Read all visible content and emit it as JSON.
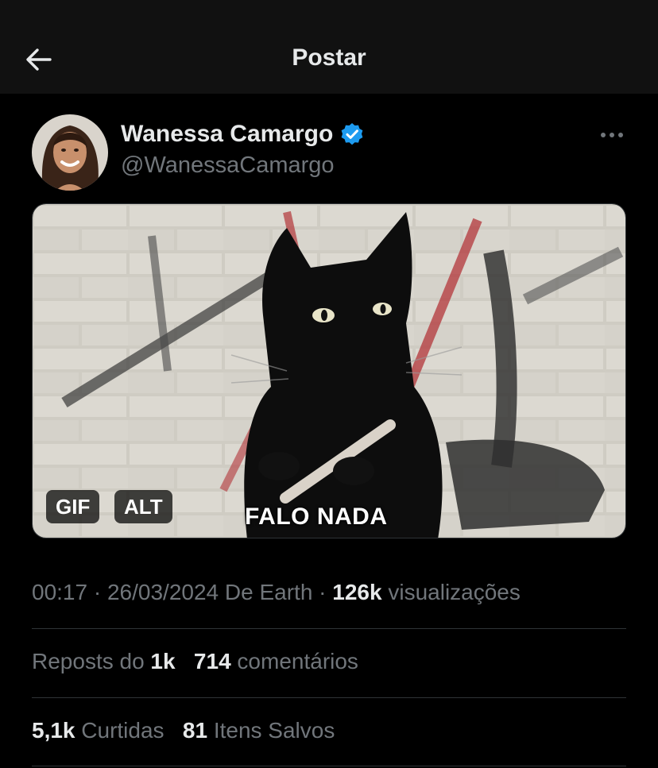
{
  "header": {
    "title": "Postar",
    "back_icon": "arrow-left-icon"
  },
  "author": {
    "display_name": "Wanessa Camargo",
    "handle": "@WanessaCamargo",
    "verified_color": "#1d9bf0",
    "avatar": "avatar-photo"
  },
  "media": {
    "caption": "FALO NADA",
    "gif_badge": "GIF",
    "alt_badge": "ALT"
  },
  "meta": {
    "time": "00:17",
    "date": "26/03/2024",
    "source": "De Earth",
    "views_count": "126k",
    "views_label": "visualizações"
  },
  "stats": {
    "reposts_label": "Reposts do",
    "reposts_count": "1k",
    "comments_count": "714",
    "comments_label": "comentários",
    "likes_count": "5,1k",
    "likes_label": "Curtidas",
    "saves_count": "81",
    "saves_label": "Itens Salvos"
  },
  "colors": {
    "background": "#000000",
    "header_background": "#111111",
    "muted_text": "#71767b",
    "primary_text": "#e7e9ea",
    "divider": "#2f3336"
  }
}
